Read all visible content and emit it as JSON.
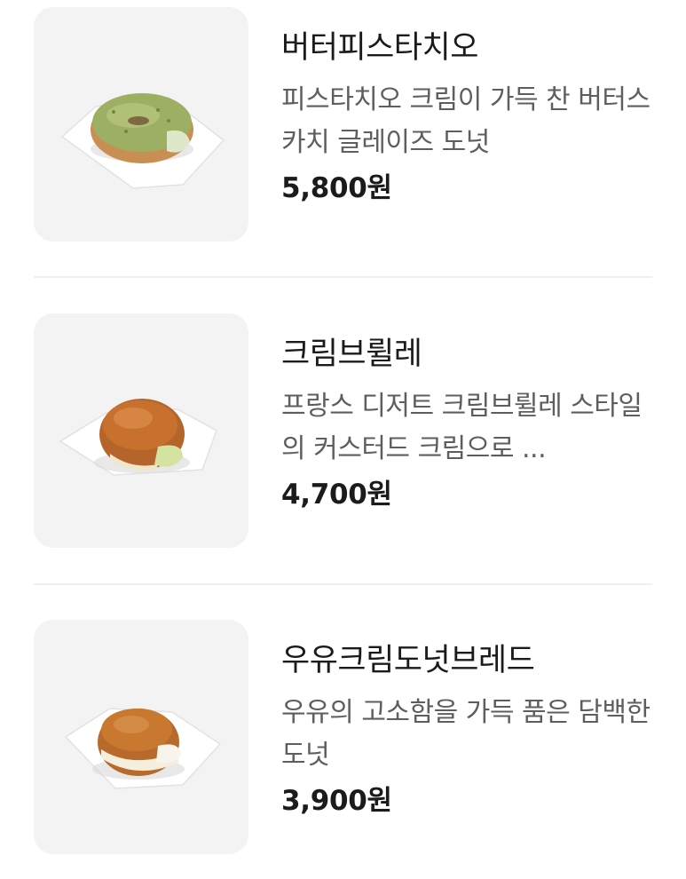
{
  "menu": {
    "items": [
      {
        "name": "버터피스타치오",
        "description": "피스타치오 크림이 가득 찬 버터스카치 글레이즈 도넛",
        "price": "5,800원",
        "image_icon": "pistachio-donut-icon"
      },
      {
        "name": "크림브륄레",
        "description": "프랑스 디저트 크림브륄레 스타일의 커스터드 크림으로 ...",
        "price": "4,700원",
        "image_icon": "creme-brulee-donut-icon"
      },
      {
        "name": "우유크림도넛브레드",
        "description": "우유의 고소함을 가득 품은 담백한 도넛",
        "price": "3,900원",
        "image_icon": "milk-cream-donut-icon"
      }
    ]
  },
  "colors": {
    "thumb_background": "#f3f3f4",
    "name_text": "#1b1b1b",
    "description_text": "#5e5e5e",
    "divider": "#efefef"
  }
}
